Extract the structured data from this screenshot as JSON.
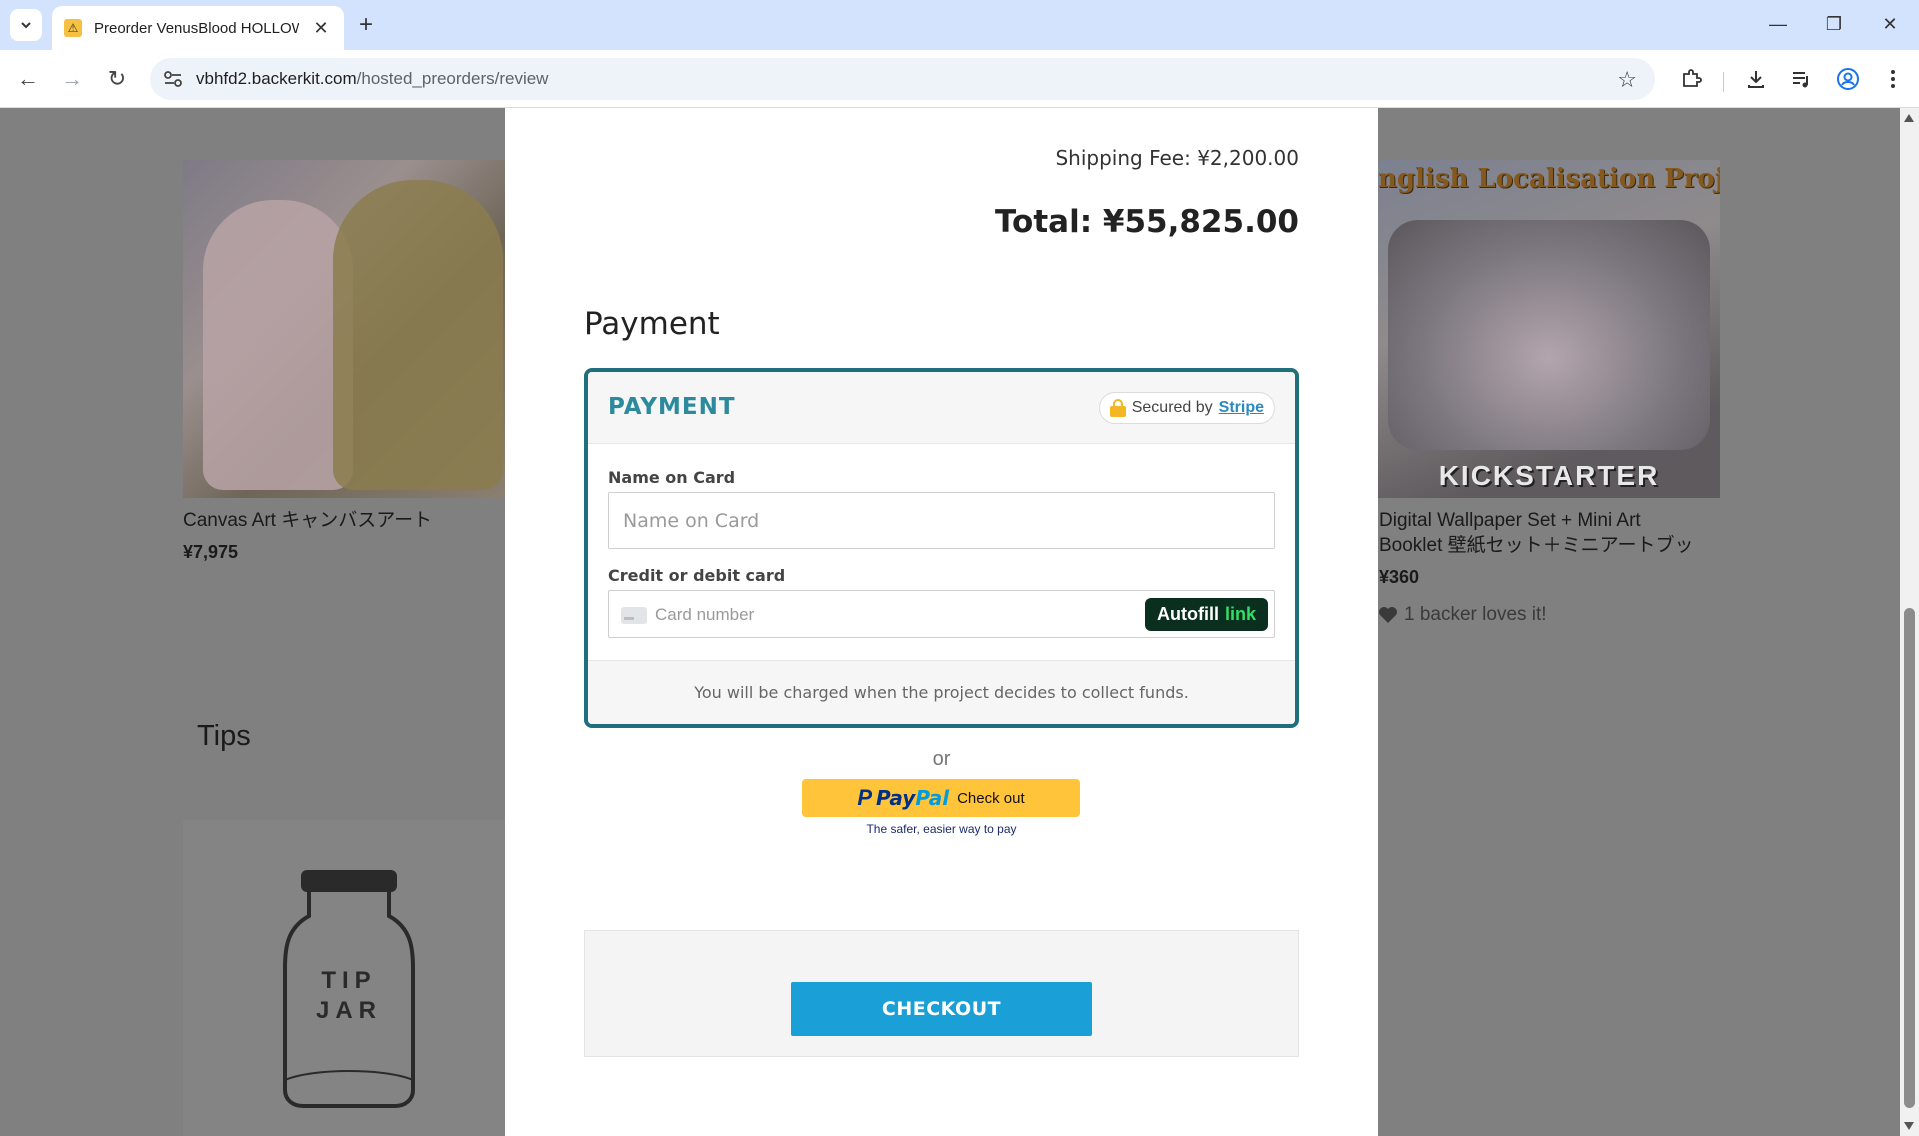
{
  "browser": {
    "tab_title": "Preorder VenusBlood HOLLOW",
    "url_host": "vbhfd2.backerkit.com",
    "url_path": "/hosted_preorders/review"
  },
  "background": {
    "products": [
      {
        "name": "Canvas Art キャンバスアート",
        "price": "¥7,975"
      },
      {
        "name_line1": "Digital Wallpaper Set + Mini Art",
        "name_line2": "Booklet 壁紙セット＋ミニアートブッ",
        "price": "¥360",
        "loves": "1 backer loves it!",
        "banner": "nglish Localisation Proje",
        "badge": "KICKSTARTER"
      }
    ],
    "tips_heading": "Tips",
    "tip_jar_line1": "TIP",
    "tip_jar_line2": "JAR"
  },
  "modal": {
    "shipping_fee": "Shipping Fee: ¥2,200.00",
    "total": "Total: ¥55,825.00",
    "payment_heading": "Payment",
    "stripe": {
      "title": "PAYMENT",
      "secured_by": "Secured by",
      "stripe_link": "Stripe",
      "name_label": "Name on Card",
      "name_placeholder": "Name on Card",
      "card_label": "Credit or debit card",
      "card_placeholder": "Card number",
      "autofill": "Autofill",
      "link": "link",
      "footer_note": "You will be charged when the project decides to collect funds."
    },
    "or": "or",
    "paypal": {
      "pay": "Pay",
      "pal": "Pal",
      "check_out": "Check out",
      "tagline": "The safer, easier way to pay"
    },
    "checkout_label": "CHECKOUT"
  },
  "colors": {
    "stripe_border": "#1f6f7c",
    "stripe_title": "#2b8a9d",
    "checkout_button": "#1a9fd6",
    "paypal_button": "#ffc439",
    "link_badge_bg": "#0a2f1f",
    "link_badge_text": "#33dd66"
  }
}
